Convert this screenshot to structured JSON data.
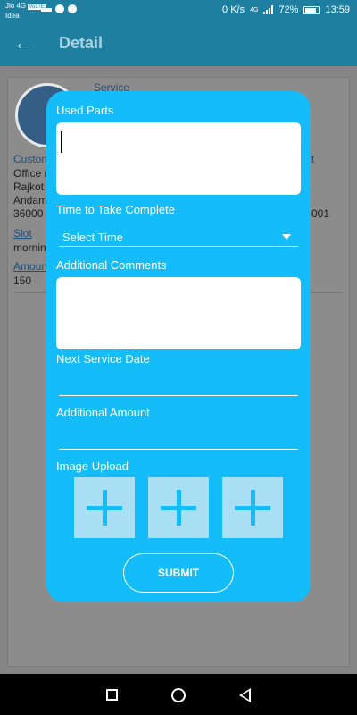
{
  "status_bar": {
    "carrier_primary": "Jio 4G",
    "carrier_badge": "VoLTE",
    "carrier_secondary": "Idea",
    "network_speed": "0 K/s",
    "network_type": "4G",
    "battery_percent": "72%",
    "time": "13:59"
  },
  "app_bar": {
    "title": "Detail",
    "back_icon": "arrow-left-icon"
  },
  "background": {
    "service_label": "Service",
    "customer_link": "Custom",
    "address_line1": "Office n",
    "address_line2": "Rajkot",
    "address_line3": "Andam",
    "address_line4": "36000",
    "right_link": "t",
    "right_number": "001",
    "slot_link": "Slot",
    "slot_value": "mornin",
    "amount_link": "Amoun",
    "amount_value": "150"
  },
  "dialog": {
    "used_parts_label": "Used Parts",
    "used_parts_value": "",
    "time_label": "Time to Take Complete",
    "time_select_value": "Select Time",
    "comments_label": "Additional Comments",
    "comments_value": "",
    "next_service_label": "Next Service Date",
    "next_service_value": "",
    "additional_amount_label": "Additional Amount",
    "additional_amount_value": "",
    "image_upload_label": "Image Upload",
    "submit_label": "SUBMIT"
  },
  "colors": {
    "dialog_bg": "#14bdf9",
    "app_bar": "#1f7fa0",
    "upload_tile": "#a8dff5"
  }
}
